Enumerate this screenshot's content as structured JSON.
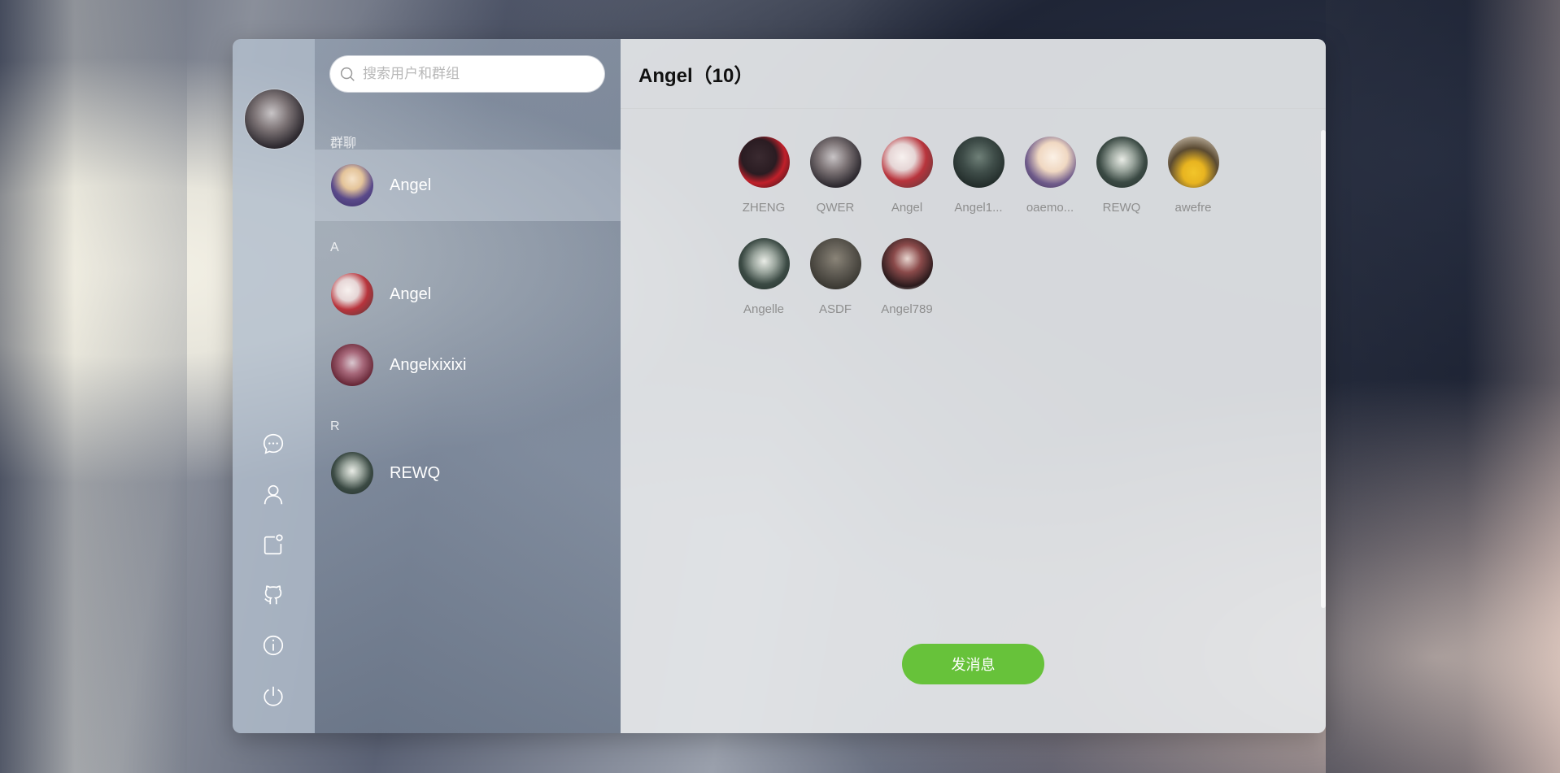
{
  "search": {
    "placeholder": "搜索用户和群组"
  },
  "sidebar": {
    "icons": [
      "chat-icon",
      "user-icon",
      "notification-icon",
      "github-icon",
      "info-icon",
      "power-icon"
    ]
  },
  "contacts": {
    "groups_label": "群聊",
    "groups": [
      {
        "name": "Angel"
      }
    ],
    "sections": [
      {
        "letter": "A",
        "items": [
          {
            "name": "Angel"
          },
          {
            "name": "Angelxixixi"
          }
        ]
      },
      {
        "letter": "R",
        "items": [
          {
            "name": "REWQ"
          }
        ]
      }
    ]
  },
  "main": {
    "title": "Angel（10）",
    "members": [
      {
        "name": "ZHENG"
      },
      {
        "name": "QWER"
      },
      {
        "name": "Angel"
      },
      {
        "name": "Angel1..."
      },
      {
        "name": "oaemo..."
      },
      {
        "name": "REWQ"
      },
      {
        "name": "awefre"
      },
      {
        "name": "Angelle"
      },
      {
        "name": "ASDF"
      },
      {
        "name": "Angel789"
      }
    ],
    "send_label": "发消息"
  },
  "colors": {
    "accent": "#67c23a"
  }
}
